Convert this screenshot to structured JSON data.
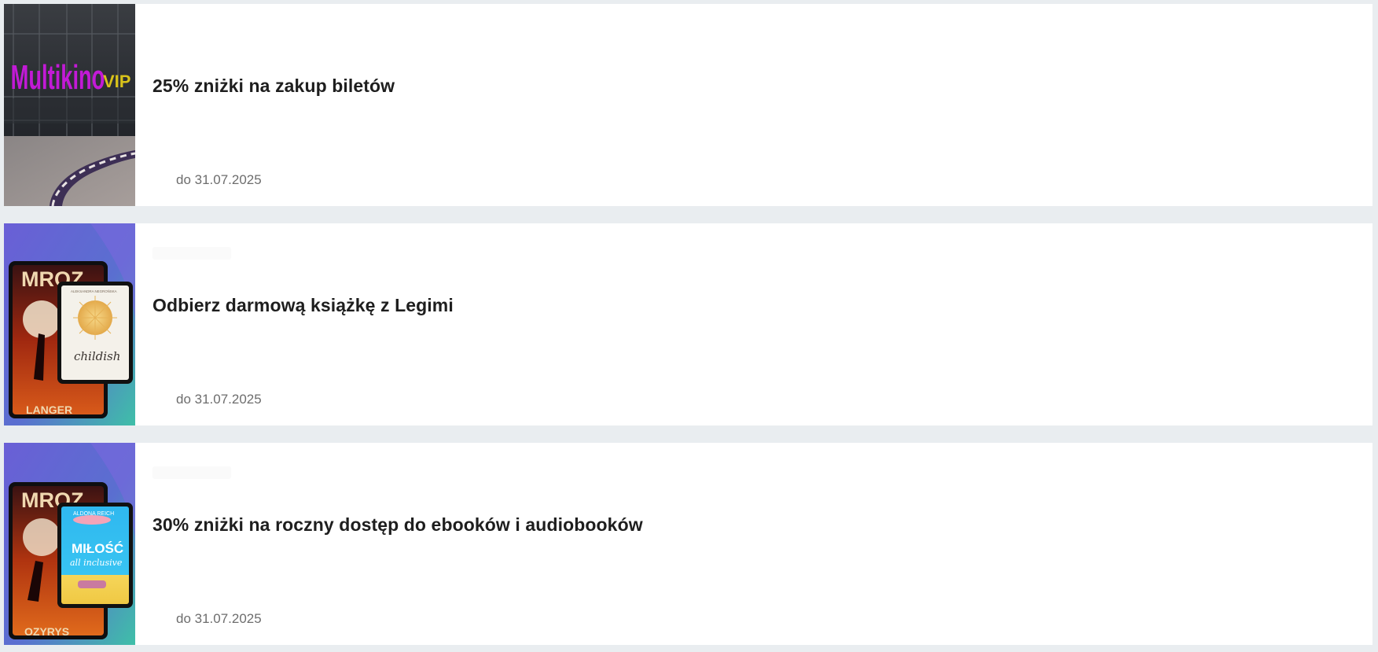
{
  "offers": [
    {
      "title": "25% zniżki na zakup biletów",
      "validity": "do 31.07.2025",
      "image": {
        "brand_sign": "Multikino",
        "sign_suffix": "VIP"
      }
    },
    {
      "title": "Odbierz darmową książkę z Legimi",
      "validity": "do 31.07.2025",
      "image": {
        "book_back_title": "MROZ",
        "book_back_subtitle": "LANGER",
        "book_front_author": "ALEKSANDRA NEGROŃSKA",
        "book_front_title": "childish"
      }
    },
    {
      "title": "30% zniżki na roczny dostęp do ebooków i audiobooków",
      "validity": "do 31.07.2025",
      "image": {
        "book_back_title": "MROZ",
        "book_back_subtitle": "OZYRYS",
        "book_front_author": "ALDONA REICH",
        "book_front_title": "MIŁOŚĆ",
        "book_front_subtitle": "all inclusive"
      }
    }
  ],
  "colors": {
    "page_bg": "#e9edf0",
    "card_bg": "#ffffff",
    "title": "#1e1e1e",
    "validity": "#6d6d6d",
    "sign_magenta": "#c21ad6"
  }
}
